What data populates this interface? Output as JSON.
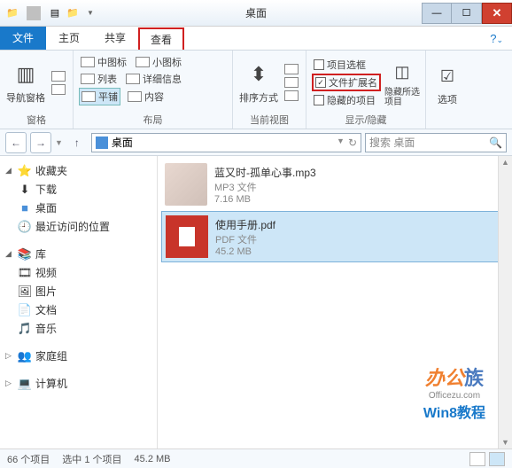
{
  "window": {
    "title": "桌面"
  },
  "tabs": {
    "file": "文件",
    "home": "主页",
    "share": "共享",
    "view": "查看"
  },
  "ribbon": {
    "panes": {
      "label": "窗格",
      "nav_pane": "导航窗格"
    },
    "layout": {
      "label": "布局",
      "medium_icons": "中图标",
      "small_icons": "小图标",
      "list": "列表",
      "details": "详细信息",
      "tiles": "平铺",
      "content": "内容"
    },
    "current_view": {
      "label": "当前视图",
      "sort": "排序方式"
    },
    "show_hide": {
      "label": "显示/隐藏",
      "item_checkboxes": "项目选框",
      "file_extensions": "文件扩展名",
      "hidden_items": "隐藏的项目",
      "hide_selected": "隐藏所选项目"
    },
    "options": "选项"
  },
  "nav": {
    "location": "桌面",
    "search_placeholder": "搜索 桌面"
  },
  "sidebar": {
    "favorites": "收藏夹",
    "downloads": "下载",
    "desktop": "桌面",
    "recent": "最近访问的位置",
    "libraries": "库",
    "videos": "视频",
    "pictures": "图片",
    "documents": "文档",
    "music": "音乐",
    "homegroup": "家庭组",
    "computer": "计算机"
  },
  "files": [
    {
      "name": "蓝又时-孤单心事.mp3",
      "type": "MP3 文件",
      "size": "7.16 MB"
    },
    {
      "name": "使用手册.pdf",
      "type": "PDF 文件",
      "size": "45.2 MB"
    }
  ],
  "status": {
    "count": "66 个项目",
    "selected": "选中 1 个项目",
    "size": "45.2 MB"
  },
  "watermark": {
    "brand_a": "办公",
    "brand_b": "族",
    "site": "Officezu.com",
    "tag": "Win8教程"
  }
}
